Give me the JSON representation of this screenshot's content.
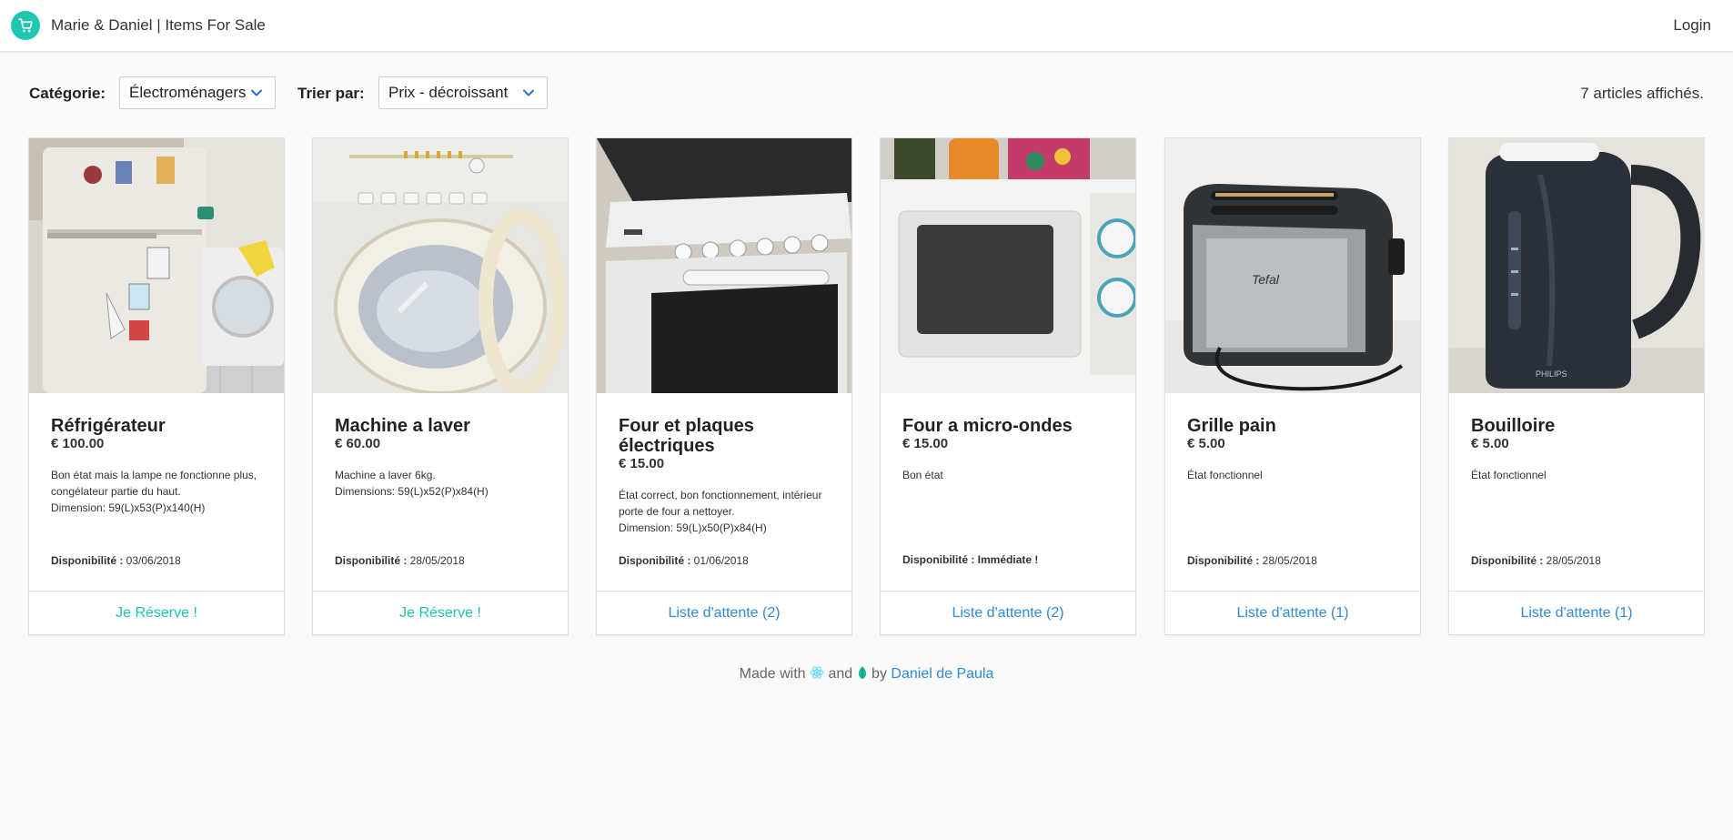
{
  "header": {
    "title": "Marie & Daniel | Items For Sale",
    "login_label": "Login",
    "brand_icon": "shopping-cart-icon",
    "accent": "#1fc6b0"
  },
  "filters": {
    "category_label": "Catégorie:",
    "category_value": "Électroménagers",
    "sort_label": "Trier par:",
    "sort_value": "Prix - décroissant",
    "count_text": "7 articles affichés."
  },
  "items": [
    {
      "title": "Réfrigérateur",
      "price": "€ 100.00",
      "description": "Bon état mais la lampe ne fonctionne plus,\ncongélateur partie du haut.\nDimension: 59(L)x53(P)x140(H)",
      "availability_label": "Disponibilité :",
      "availability_value": " 03/06/2018",
      "action": "Je Réserve !"
    },
    {
      "title": "Machine a laver",
      "price": "€ 60.00",
      "description": "Machine a laver 6kg.\nDimensions: 59(L)x52(P)x84(H)",
      "availability_label": "Disponibilité :",
      "availability_value": " 28/05/2018",
      "action": "Je Réserve !"
    },
    {
      "title": "Four et plaques électriques",
      "price": "€ 15.00",
      "description": "État correct, bon fonctionnement, intérieur\nporte de four a nettoyer.\nDimension: 59(L)x50(P)x84(H)",
      "availability_label": "Disponibilité :",
      "availability_value": " 01/06/2018",
      "action": "Liste d'attente (2)"
    },
    {
      "title": "Four a micro-ondes",
      "price": "€ 15.00",
      "description": "Bon état",
      "availability_label": "Disponibilité :",
      "availability_value": " Immédiate !",
      "action": "Liste d'attente (2)"
    },
    {
      "title": "Grille pain",
      "price": "€ 5.00",
      "description": "État fonctionnel",
      "availability_label": "Disponibilité :",
      "availability_value": " 28/05/2018",
      "action": "Liste d'attente (1)"
    },
    {
      "title": "Bouilloire",
      "price": "€ 5.00",
      "description": "État fonctionnel",
      "availability_label": "Disponibilité :",
      "availability_value": " 28/05/2018",
      "action": "Liste d'attente (1)"
    }
  ],
  "footer": {
    "made_with": "Made with",
    "and": "and",
    "by": "by",
    "author": "Daniel de Paula",
    "icons": [
      "react-icon",
      "leaf-icon"
    ]
  }
}
